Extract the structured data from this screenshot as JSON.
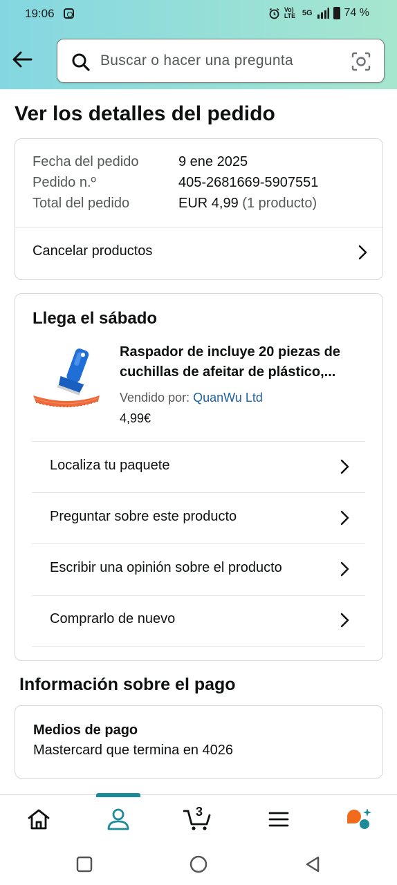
{
  "status_bar": {
    "time": "19:06",
    "network_top": "Vo) LTE",
    "network": "5G",
    "battery": "74 %"
  },
  "search": {
    "placeholder": "Buscar o hacer una pregunta"
  },
  "page": {
    "title": "Ver los detalles del pedido"
  },
  "order_summary": {
    "date_label": "Fecha del pedido",
    "date_value": "9 ene 2025",
    "number_label": "Pedido n.º",
    "number_value": "405-2681669-5907551",
    "total_label": "Total del pedido",
    "total_value": "EUR 4,99",
    "total_extra": "(1 producto)",
    "cancel_label": "Cancelar productos"
  },
  "shipment": {
    "arrival": "Llega el sábado",
    "product_title": "Raspador de incluye 20 piezas de cuchillas de afeitar de plástico,...",
    "sold_by_label": "Vendido por:",
    "seller": "QuanWu Ltd",
    "price": "4,99€",
    "actions": [
      {
        "label": "Localiza tu paquete"
      },
      {
        "label": "Preguntar sobre este producto"
      },
      {
        "label": "Escribir una opinión sobre el producto"
      },
      {
        "label": "Comprarlo de nuevo"
      }
    ]
  },
  "payment": {
    "section_title": "Información sobre el pago",
    "methods_label": "Medios de pago",
    "methods_value": "Mastercard  que termina en 4026"
  },
  "bottom_nav": {
    "cart_count": "3",
    "items": [
      "home-icon",
      "account-icon",
      "cart-icon",
      "menu-icon",
      "rufus-icon"
    ],
    "active": "account-icon",
    "accent_color": "#1d8a99"
  },
  "colors": {
    "header_gradient_start": "#84d7e1",
    "header_gradient_end": "#a6e6cf",
    "link": "#2162a1",
    "secondary_text": "#565959"
  }
}
